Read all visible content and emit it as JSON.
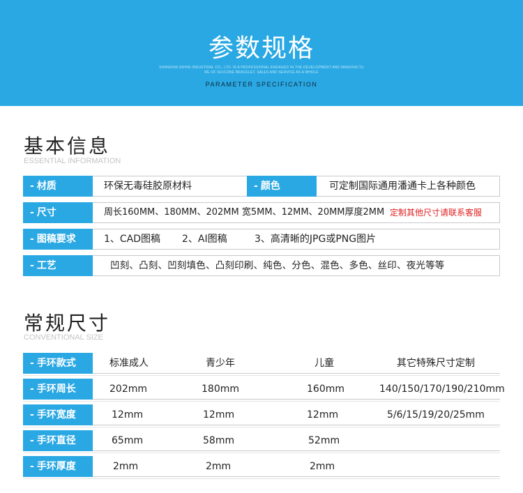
{
  "banner": {
    "title": "参数规格",
    "desc_line1": "SHANGHAI ERHAI INDUSTRIAL CO., LTD. IS A PROFESSIONAL ENGAGED IN THE DEVELOPMENT AND MANUFACTU",
    "desc_line2": "RE OF SILICONE BRACELET, SALES AND SERVICE AS A WHOLE",
    "subtitle": "PARAMETER SPECIFICATION"
  },
  "basic": {
    "title": "基本信息",
    "title_en": "ESSENTIAL INFORMATION",
    "material_label": "材质",
    "material_value": "环保无毒硅胶原材料",
    "color_label": "颜色",
    "color_value": "可定制国际通用潘通卡上各种颜色",
    "size_label": "尺寸",
    "size_value": "周长160MM、180MM、202MM 宽5MM、12MM、20MM厚度2MM",
    "size_note": "定制其他尺寸请联系客服",
    "draft_label": "图稿要求",
    "draft_1": "1、CAD图稿",
    "draft_2": "2、AI图稿",
    "draft_3": "3、高清晰的JPG或PNG图片",
    "craft_label": "工艺",
    "craft_value": "凹刻、凸刻、凹刻填色、凸刻印刷、纯色、分色、混色、多色、丝印、夜光等等"
  },
  "sizes": {
    "title": "常规尺寸",
    "title_en": "CONVENTIONAL SIZE",
    "rows": [
      {
        "label": "手环款式",
        "c1": "标准成人",
        "c2": "青少年",
        "c3": "儿童",
        "c4": "其它特殊尺寸定制"
      },
      {
        "label": "手环周长",
        "c1": "202mm",
        "c2": "180mm",
        "c3": "160mm",
        "c4": "140/150/170/190/210mm"
      },
      {
        "label": "手环宽度",
        "c1": "12mm",
        "c2": "12mm",
        "c3": "12mm",
        "c4": "5/6/15/19/20/25mm"
      },
      {
        "label": "手环直径",
        "c1": "65mm",
        "c2": "58mm",
        "c3": "52mm",
        "c4": ""
      },
      {
        "label": "手环厚度",
        "c1": "2mm",
        "c2": "2mm",
        "c3": "2mm",
        "c4": ""
      }
    ]
  },
  "colors": {
    "accent": "#2aa8e3",
    "note_red": "#e02020"
  }
}
